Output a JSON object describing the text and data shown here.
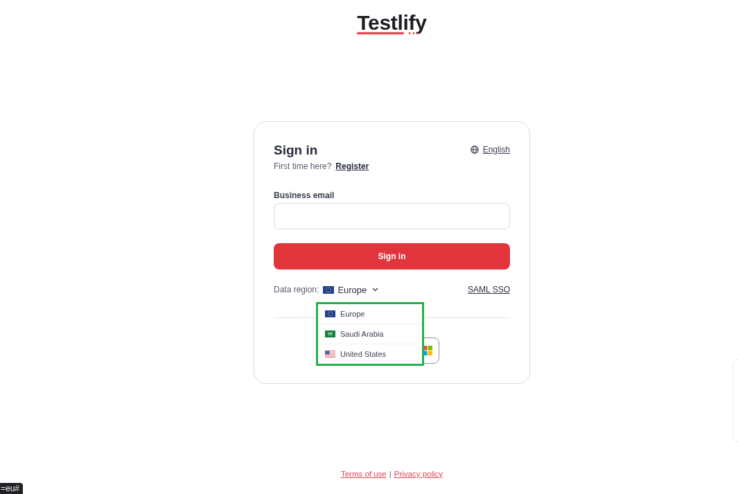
{
  "logo": {
    "text": "Testlify"
  },
  "card": {
    "title": "Sign in",
    "language": "English",
    "prompt": "First time here?",
    "register_link": "Register",
    "email_field": {
      "label": "Business email"
    },
    "submit_button": "Sign in",
    "data_region": {
      "label": "Data region:",
      "value": "Europe",
      "kind": "eu",
      "expanded": true,
      "highlighted": true,
      "options": [
        {
          "label": "Europe",
          "kind": "eu"
        },
        {
          "label": "Saudi Arabia",
          "kind": "sa"
        },
        {
          "label": "United States",
          "kind": "us"
        }
      ]
    },
    "saml_link": "SAML SSO",
    "social_buttons": [
      {
        "kind": "microsoft"
      }
    ]
  },
  "footer": {
    "links": [
      "Terms of use",
      "Privacy policy"
    ],
    "separator": "|"
  },
  "status_bar": {
    "url": "=eu#"
  }
}
